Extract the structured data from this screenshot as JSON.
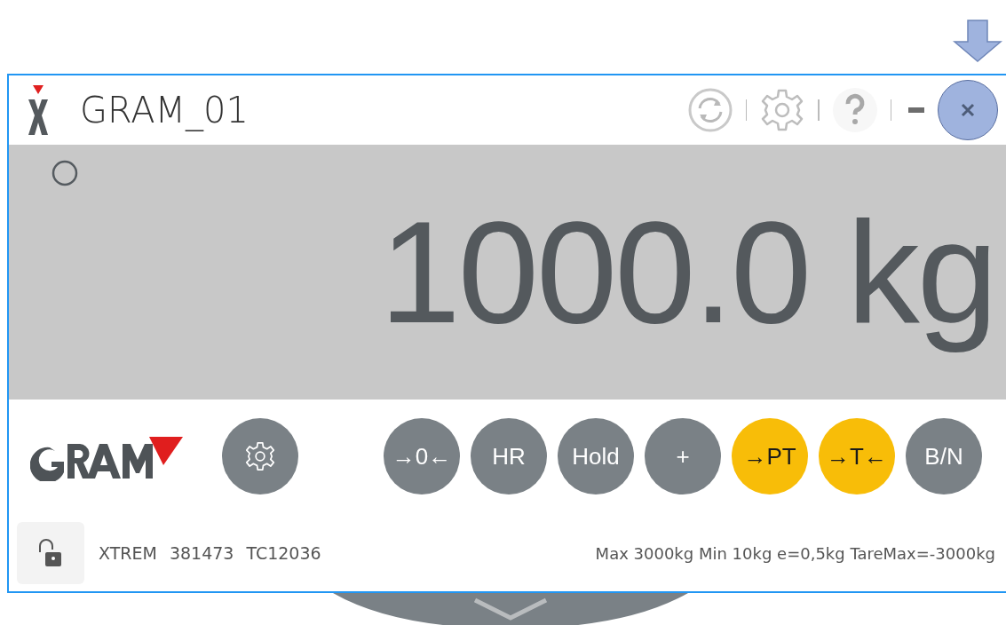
{
  "window": {
    "title": "GRAM_01"
  },
  "display": {
    "weight": "1000.0 kg"
  },
  "buttons": [
    {
      "label": "→0←",
      "active": false
    },
    {
      "label": "HR",
      "active": false
    },
    {
      "label": "Hold",
      "active": false
    },
    {
      "label": "+",
      "active": false
    },
    {
      "label": "→PT",
      "active": true
    },
    {
      "label": "→T←",
      "active": true
    },
    {
      "label": "B/N",
      "active": false
    }
  ],
  "status_bar": {
    "locked": false,
    "model": "XTREM",
    "serial": "381473",
    "certificate": "TC12036",
    "specs": "Max 3000kg Min 10kg  e=0,5kg TareMax=-3000kg"
  }
}
